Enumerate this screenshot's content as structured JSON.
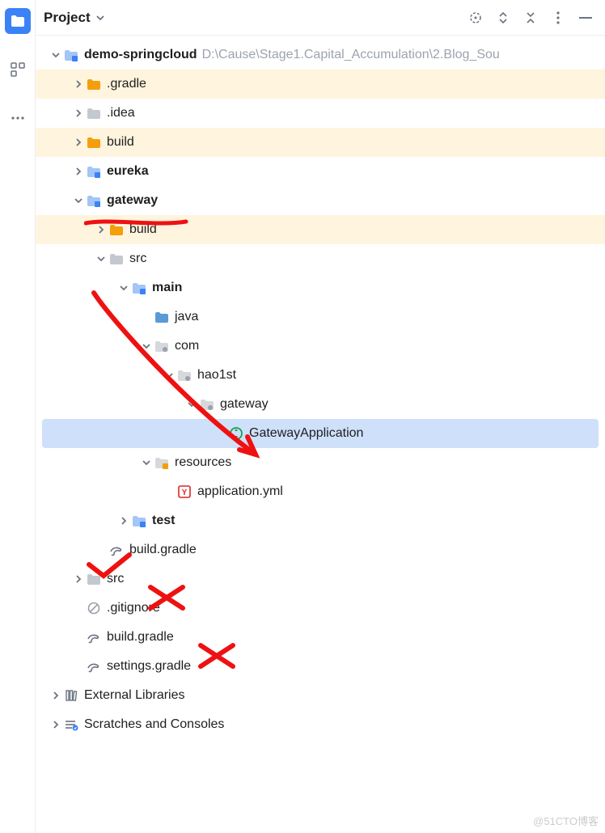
{
  "header": {
    "title": "Project"
  },
  "rows": [
    {
      "id": "root",
      "indent": 0,
      "arrow": "down",
      "icon": "module",
      "label": "demo-springcloud",
      "bold": true,
      "path": "D:\\Cause\\Stage1.Capital_Accumulation\\2.Blog_Sou"
    },
    {
      "id": "gradle-dir",
      "indent": 1,
      "arrow": "right",
      "icon": "folder-orange",
      "label": ".gradle",
      "hl": true
    },
    {
      "id": "idea-dir",
      "indent": 1,
      "arrow": "right",
      "icon": "folder-gray",
      "label": ".idea"
    },
    {
      "id": "build-dir",
      "indent": 1,
      "arrow": "right",
      "icon": "folder-orange",
      "label": "build",
      "hl": true
    },
    {
      "id": "eureka",
      "indent": 1,
      "arrow": "right",
      "icon": "module",
      "label": "eureka",
      "bold": true
    },
    {
      "id": "gateway",
      "indent": 1,
      "arrow": "down",
      "icon": "module",
      "label": "gateway",
      "bold": true
    },
    {
      "id": "gw-build",
      "indent": 2,
      "arrow": "right",
      "icon": "folder-orange",
      "label": "build",
      "hl": true
    },
    {
      "id": "gw-src",
      "indent": 2,
      "arrow": "down",
      "icon": "folder-gray",
      "label": "src"
    },
    {
      "id": "main",
      "indent": 3,
      "arrow": "down",
      "icon": "module",
      "label": "main",
      "bold": true
    },
    {
      "id": "java",
      "indent": 4,
      "arrow": "none",
      "icon": "folder-blue",
      "label": "java"
    },
    {
      "id": "com",
      "indent": 4,
      "arrow": "down",
      "icon": "package",
      "label": "com"
    },
    {
      "id": "hao1st",
      "indent": 5,
      "arrow": "down",
      "icon": "package",
      "label": "hao1st"
    },
    {
      "id": "gateway-pkg",
      "indent": 6,
      "arrow": "down",
      "icon": "package",
      "label": "gateway"
    },
    {
      "id": "gw-app",
      "indent": 7,
      "arrow": "none",
      "icon": "class",
      "label": "GatewayApplication",
      "sel": true
    },
    {
      "id": "resources",
      "indent": 4,
      "arrow": "down",
      "icon": "resources",
      "label": "resources"
    },
    {
      "id": "app-yml",
      "indent": 5,
      "arrow": "none",
      "icon": "yaml",
      "label": "application.yml"
    },
    {
      "id": "test",
      "indent": 3,
      "arrow": "right",
      "icon": "module",
      "label": "test",
      "bold": true
    },
    {
      "id": "gw-buildgradle",
      "indent": 2,
      "arrow": "none",
      "icon": "gradle",
      "label": "build.gradle"
    },
    {
      "id": "root-src",
      "indent": 1,
      "arrow": "right",
      "icon": "folder-gray",
      "label": "src"
    },
    {
      "id": "gitignore",
      "indent": 1,
      "arrow": "none",
      "icon": "gitignore",
      "label": ".gitignore"
    },
    {
      "id": "root-buildgradle",
      "indent": 1,
      "arrow": "none",
      "icon": "gradle",
      "label": "build.gradle"
    },
    {
      "id": "settings",
      "indent": 1,
      "arrow": "none",
      "icon": "gradle",
      "label": "settings.gradle"
    },
    {
      "id": "ext-libs",
      "indent": 0,
      "arrow": "right",
      "icon": "libraries",
      "label": "External Libraries"
    },
    {
      "id": "scratches",
      "indent": 0,
      "arrow": "right",
      "icon": "scratches",
      "label": "Scratches and Consoles"
    }
  ],
  "watermark": "@51CTO博客"
}
